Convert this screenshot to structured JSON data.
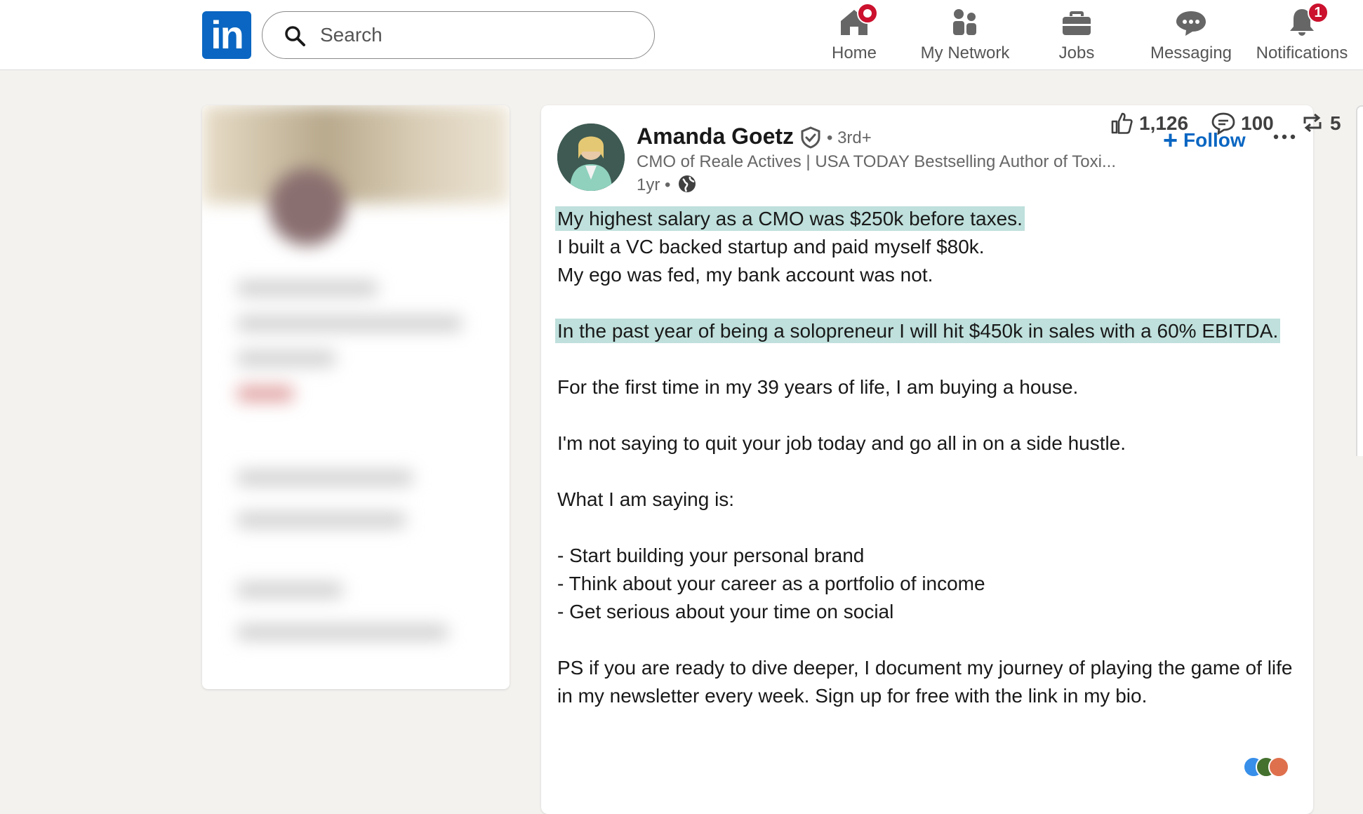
{
  "nav": {
    "logo_text": "in",
    "search_placeholder": "Search",
    "items": [
      {
        "label": "Home",
        "icon": "home-icon",
        "badge": ""
      },
      {
        "label": "My Network",
        "icon": "network-icon",
        "badge": ""
      },
      {
        "label": "Jobs",
        "icon": "briefcase-icon",
        "badge": ""
      },
      {
        "label": "Messaging",
        "icon": "messaging-icon",
        "badge": ""
      },
      {
        "label": "Notifications",
        "icon": "bell-icon",
        "badge": "1"
      }
    ]
  },
  "post": {
    "author": "Amanda Goetz",
    "degree": "• 3rd+",
    "headline": "CMO of Reale Actives | USA TODAY Bestselling Author of Toxi...",
    "time": "1yr •",
    "follow_label": "Follow",
    "body": [
      {
        "text": "My highest salary as a CMO was $250k before taxes.",
        "highlight": true
      },
      {
        "text": "I built a VC backed startup and paid myself $80k.",
        "highlight": false
      },
      {
        "text": "My ego was fed, my bank account was not.",
        "highlight": false
      },
      {
        "text": "",
        "highlight": false
      },
      {
        "text": "In the past year of being a solopreneur I will hit $450k in sales with a 60% EBITDA.",
        "highlight": true
      },
      {
        "text": "",
        "highlight": false
      },
      {
        "text": "For the first time in my 39 years of life, I am buying a house.",
        "highlight": false
      },
      {
        "text": "",
        "highlight": false
      },
      {
        "text": "I'm not saying to quit your job today and go all in on a side hustle.",
        "highlight": false
      },
      {
        "text": "",
        "highlight": false
      },
      {
        "text": "What I am saying is:",
        "highlight": false
      },
      {
        "text": "",
        "highlight": false
      },
      {
        "text": "- Start building your personal brand",
        "highlight": false
      },
      {
        "text": "- Think about your career as a portfolio of income",
        "highlight": false
      },
      {
        "text": "- Get serious about your time on social",
        "highlight": false
      },
      {
        "text": "",
        "highlight": false
      },
      {
        "text": "PS if you are ready to dive deeper, I document my journey of playing the game of life in my newsletter every week. Sign up for free with the link in my bio.",
        "highlight": false
      }
    ],
    "actions": {
      "likes": "1,126",
      "comments": "100",
      "reposts": "5"
    }
  },
  "colors": {
    "brand": "#0a66c2",
    "highlight": "#bfe0dc",
    "badge": "#cb112d"
  }
}
